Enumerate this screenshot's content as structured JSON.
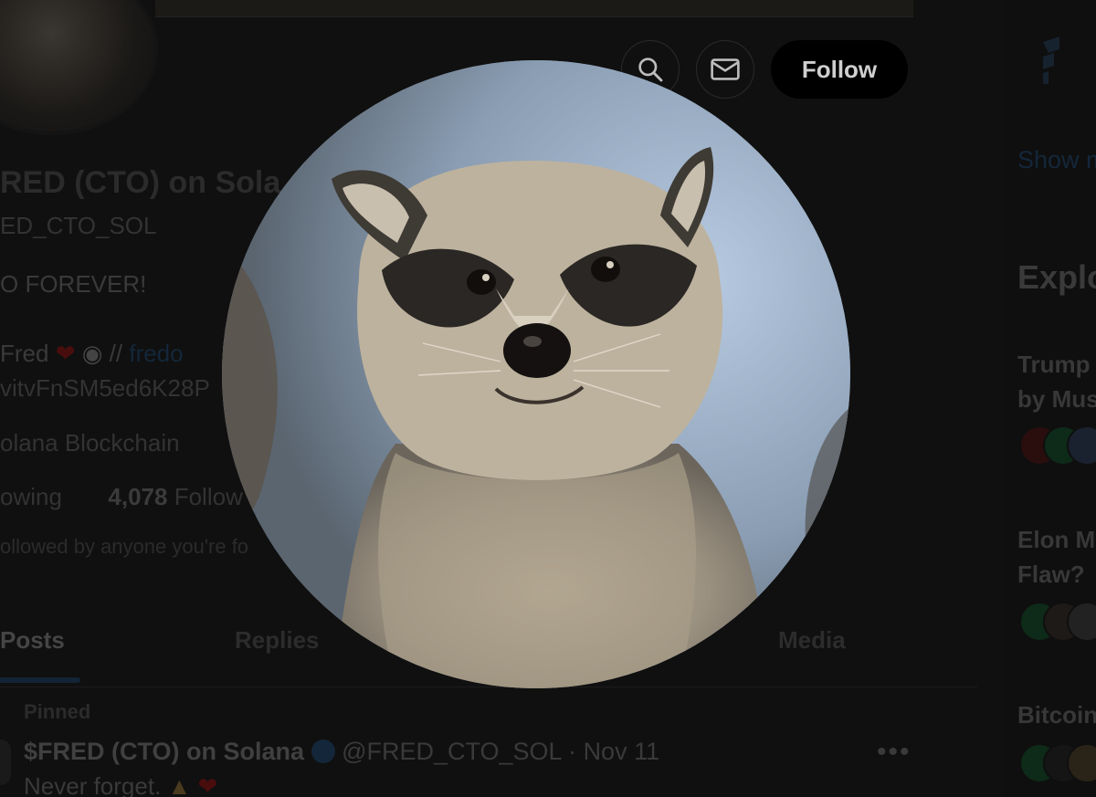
{
  "profile": {
    "name": "$FRED (CTO) on Solana",
    "name_visible": "RED (CTO) on Sola",
    "handle_visible": "ED_CTO_SOL",
    "bio_line1": "O FOREVER!",
    "bio_line2_prefix": "Fred",
    "bio_line2_link": "fredo",
    "bio_line3": "vitvFnSM5ed6K28P",
    "location": "olana Blockchain",
    "following_label": "owing",
    "followers_count": "4,078",
    "followers_label": "Follow",
    "not_followed": "ollowed by anyone you're fo"
  },
  "actions": {
    "follow_label": "Follow",
    "search_icon": "search-icon",
    "message_icon": "mail-icon"
  },
  "tabs": [
    {
      "label": "Posts",
      "active": true
    },
    {
      "label": "Replies",
      "active": false
    },
    {
      "label": "Media",
      "active": false
    }
  ],
  "post": {
    "pinned_label": "Pinned",
    "author": "$FRED (CTO) on Solana",
    "handle": "@FRED_CTO_SOL",
    "date": "Nov 11",
    "text": "Never forget.",
    "more_icon": "more-horizontal-icon"
  },
  "sidebar": {
    "show_more": "Show m",
    "explore_title": "Explo",
    "headlines": [
      {
        "line1": "Trump",
        "line2": "by Mus"
      },
      {
        "line1": "Elon M",
        "line2": "Flaw?"
      },
      {
        "line1": "Bitcoin",
        "line2": ""
      }
    ]
  },
  "colors": {
    "accent": "#1d9bf0",
    "background": "#101010",
    "heart": "#c8102e"
  },
  "photo_viewer": {
    "subject": "raccoon-avatar-enlarged"
  }
}
